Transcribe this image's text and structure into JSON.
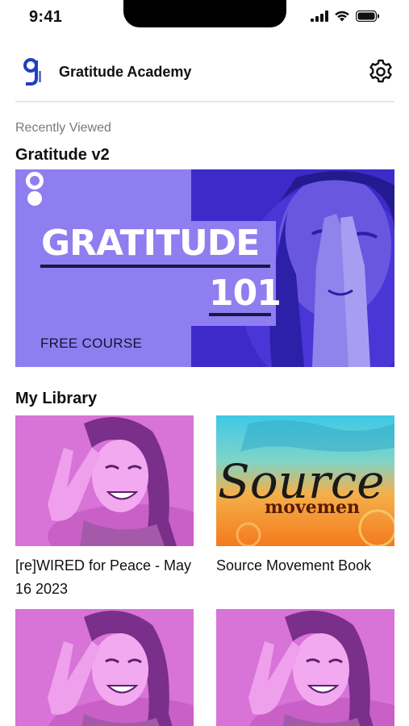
{
  "status_bar": {
    "time": "9:41"
  },
  "header": {
    "logo_letter": "g",
    "app_name": "Gratitude Academy",
    "settings_icon": "gear-icon"
  },
  "recent": {
    "caption": "Recently Viewed",
    "course_title": "Gratitude v2",
    "banner": {
      "headline": "GRATITUDE",
      "number": "101",
      "subtitle": "FREE COURSE"
    }
  },
  "library": {
    "title": "My Library",
    "items": [
      {
        "caption": "[re]WIRED for Peace - May 16 2023",
        "thumb": "woman-peace-sign-photo"
      },
      {
        "caption": "Source Movement Book",
        "thumb": "source-movement-cover",
        "cover_word_1": "Source",
        "cover_word_2": "movemen"
      },
      {
        "caption": "",
        "thumb": "woman-peace-sign-photo"
      },
      {
        "caption": "",
        "thumb": "woman-peace-sign-photo"
      }
    ]
  },
  "colors": {
    "banner_purple": "#8f7ef0",
    "banner_photo": "#3d2ac9",
    "library_magenta": "#d873d8",
    "divider": "#e6e6e6"
  }
}
